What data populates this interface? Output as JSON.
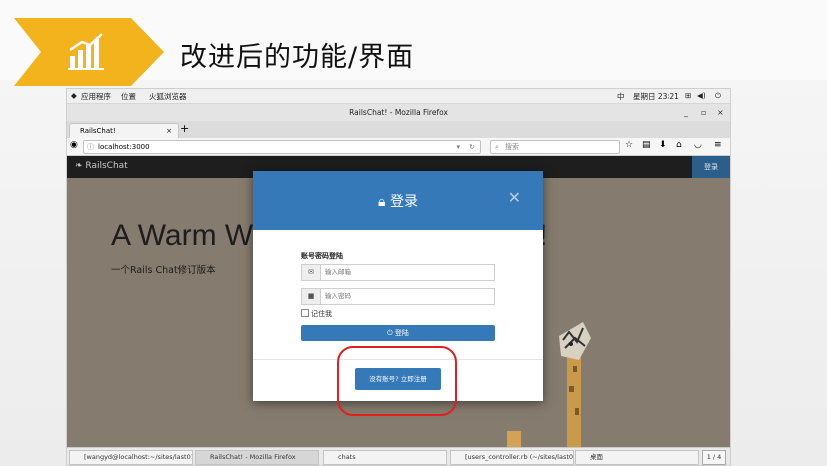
{
  "slide": {
    "title": "改进后的功能/界面",
    "accent_color": "#f2b31d",
    "icon": "growth-chart-icon"
  },
  "system_bar": {
    "apps": "应用程序",
    "places": "位置",
    "browser": "火狐浏览器",
    "input_method": "中",
    "clock": "星期日 23∶21"
  },
  "window": {
    "title": "RailsChat! - Mozilla Firefox"
  },
  "browser": {
    "tab_label": "RailsChat!",
    "url": "localhost:3000",
    "search_placeholder": "搜索"
  },
  "app": {
    "brand": "RailsChat",
    "top_login": "登录",
    "hero_title": "A Warm W",
    "hero_title_end": "!",
    "hero_subtitle": "一个Rails Chat修订版本"
  },
  "modal": {
    "title": "登录",
    "form_label": "账号密码登陆",
    "email_placeholder": "输入邮箱",
    "password_placeholder": "输入密码",
    "remember_label": "记住我",
    "submit_label": "登陆",
    "register_label": "没有账号? 立即注册",
    "primary_color": "#3579b8"
  },
  "taskbar": {
    "items": [
      "[wangyd@localhost:~/sites/last01/···",
      "RailsChat! - Mozilla Firefox",
      "chats",
      "[users_controller.rb (~/sites/last01···",
      "桌面"
    ],
    "pager": "1 / 4"
  }
}
